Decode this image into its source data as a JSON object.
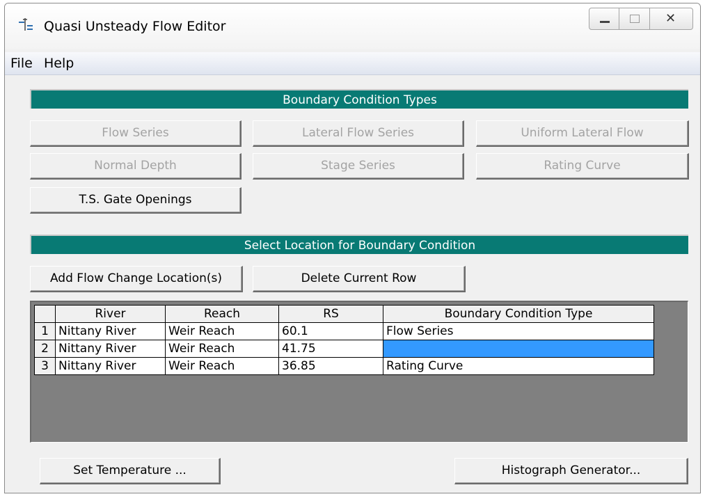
{
  "window": {
    "title": "Quasi Unsteady Flow Editor"
  },
  "menu": {
    "file": "File",
    "help": "Help"
  },
  "boundary_types": {
    "header": "Boundary Condition Types",
    "buttons": {
      "flow_series": "Flow Series",
      "lateral_flow_series": "Lateral Flow Series",
      "uniform_lateral_flow": "Uniform Lateral Flow",
      "normal_depth": "Normal Depth",
      "stage_series": "Stage Series",
      "rating_curve": "Rating Curve",
      "ts_gate_openings": "T.S. Gate Openings"
    }
  },
  "location": {
    "header": "Select Location for Boundary Condition",
    "add_button": "Add Flow Change Location(s)",
    "delete_button": "Delete Current Row"
  },
  "table": {
    "columns": [
      "River",
      "Reach",
      "RS",
      "Boundary Condition Type"
    ],
    "rows": [
      {
        "num": "1",
        "river": "Nittany River",
        "reach": "Weir Reach",
        "rs": "60.1",
        "bc_type": "Flow Series"
      },
      {
        "num": "2",
        "river": "Nittany River",
        "reach": "Weir Reach",
        "rs": "41.75",
        "bc_type": ""
      },
      {
        "num": "3",
        "river": "Nittany River",
        "reach": "Weir Reach",
        "rs": "36.85",
        "bc_type": "Rating Curve"
      }
    ]
  },
  "footer": {
    "set_temperature": "Set Temperature ...",
    "histograph_generator": "Histograph Generator..."
  },
  "colors": {
    "section_header": "#087a74",
    "selected_cell": "#3399ff",
    "grid_background": "#808080"
  }
}
